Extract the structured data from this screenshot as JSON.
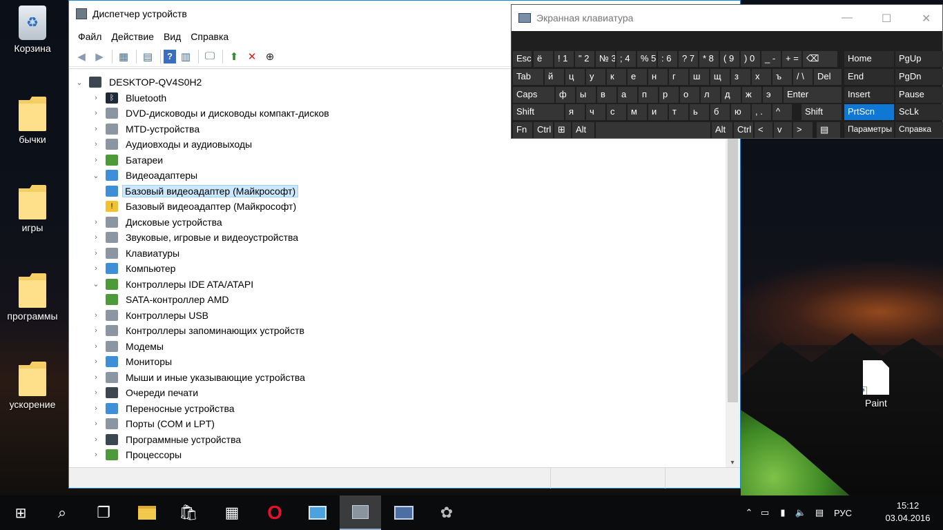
{
  "desktop": {
    "icons": [
      {
        "label": "Корзина"
      },
      {
        "label": "бычки"
      },
      {
        "label": "игры"
      },
      {
        "label": "программы"
      },
      {
        "label": "ускорение"
      },
      {
        "label": "Paint"
      }
    ]
  },
  "device_manager": {
    "title": "Диспетчер устройств",
    "menu": [
      "Файл",
      "Действие",
      "Вид",
      "Справка"
    ],
    "root": "DESKTOP-QV4S0H2",
    "tree": [
      {
        "label": "Bluetooth",
        "icon": "bluetooth-icon"
      },
      {
        "label": "DVD-дисководы и дисководы компакт-дисков",
        "icon": "dvd-drive-icon"
      },
      {
        "label": "MTD-устройства",
        "icon": "mtd-device-icon"
      },
      {
        "label": "Аудиовходы и аудиовыходы",
        "icon": "speaker-icon"
      },
      {
        "label": "Батареи",
        "icon": "battery-icon"
      },
      {
        "label": "Видеоадаптеры",
        "icon": "display-adapter-icon",
        "expanded": true
      },
      {
        "label": "Базовый видеоадаптер (Майкрософт)",
        "icon": "display-adapter-icon",
        "child": true,
        "selected": true
      },
      {
        "label": "Базовый видеоадаптер (Майкрософт)",
        "icon": "warning-icon",
        "child": true
      },
      {
        "label": "Дисковые устройства",
        "icon": "disk-drive-icon"
      },
      {
        "label": "Звуковые, игровые и видеоустройства",
        "icon": "speaker-icon"
      },
      {
        "label": "Клавиатуры",
        "icon": "keyboard-icon"
      },
      {
        "label": "Компьютер",
        "icon": "computer-icon"
      },
      {
        "label": "Контроллеры IDE ATA/ATAPI",
        "icon": "ide-controller-icon",
        "expanded": true
      },
      {
        "label": "SATA-контроллер AMD",
        "icon": "ide-controller-icon",
        "child": true
      },
      {
        "label": "Контроллеры USB",
        "icon": "usb-icon"
      },
      {
        "label": "Контроллеры запоминающих устройств",
        "icon": "storage-controller-icon"
      },
      {
        "label": "Модемы",
        "icon": "modem-icon"
      },
      {
        "label": "Мониторы",
        "icon": "monitor-icon"
      },
      {
        "label": "Мыши и иные указывающие устройства",
        "icon": "mouse-icon"
      },
      {
        "label": "Очереди печати",
        "icon": "printer-icon"
      },
      {
        "label": "Переносные устройства",
        "icon": "portable-device-icon"
      },
      {
        "label": "Порты (COM и LPT)",
        "icon": "port-icon"
      },
      {
        "label": "Программные устройства",
        "icon": "software-device-icon"
      },
      {
        "label": "Процессоры",
        "icon": "processor-icon"
      }
    ]
  },
  "osk": {
    "title": "Экранная клавиатура",
    "row1": [
      {
        "t": "Esc"
      },
      {
        "t": "ё"
      },
      {
        "t": "! 1"
      },
      {
        "t": "\" 2"
      },
      {
        "t": "№ 3"
      },
      {
        "t": "; 4"
      },
      {
        "t": "% 5"
      },
      {
        "t": ": 6"
      },
      {
        "t": "? 7"
      },
      {
        "t": "* 8"
      },
      {
        "t": "( 9"
      },
      {
        "t": ") 0"
      },
      {
        "t": "_ -"
      },
      {
        "t": "+ ="
      },
      {
        "t": "⌫"
      }
    ],
    "row2": [
      {
        "t": "Tab"
      },
      {
        "t": "й"
      },
      {
        "t": "ц"
      },
      {
        "t": "у"
      },
      {
        "t": "к"
      },
      {
        "t": "е"
      },
      {
        "t": "н"
      },
      {
        "t": "г"
      },
      {
        "t": "ш"
      },
      {
        "t": "щ"
      },
      {
        "t": "з"
      },
      {
        "t": "х"
      },
      {
        "t": "ъ"
      },
      {
        "t": "/ \\"
      },
      {
        "t": "Del"
      }
    ],
    "row3": [
      {
        "t": "Caps"
      },
      {
        "t": "ф"
      },
      {
        "t": "ы"
      },
      {
        "t": "в"
      },
      {
        "t": "а"
      },
      {
        "t": "п"
      },
      {
        "t": "р"
      },
      {
        "t": "о"
      },
      {
        "t": "л"
      },
      {
        "t": "д"
      },
      {
        "t": "ж"
      },
      {
        "t": "э"
      },
      {
        "t": "Enter"
      }
    ],
    "row4": [
      {
        "t": "Shift"
      },
      {
        "t": "я"
      },
      {
        "t": "ч"
      },
      {
        "t": "с"
      },
      {
        "t": "м"
      },
      {
        "t": "и"
      },
      {
        "t": "т"
      },
      {
        "t": "ь"
      },
      {
        "t": "б"
      },
      {
        "t": "ю"
      },
      {
        "t": ", ."
      },
      {
        "t": "^"
      },
      {
        "t": "Shift"
      }
    ],
    "row5": [
      {
        "t": "Fn"
      },
      {
        "t": "Ctrl"
      },
      {
        "t": "⊞"
      },
      {
        "t": "Alt"
      },
      {
        "t": ""
      },
      {
        "t": "Alt"
      },
      {
        "t": "Ctrl"
      },
      {
        "t": "<"
      },
      {
        "t": "v"
      },
      {
        "t": ">"
      },
      {
        "t": "▤"
      }
    ],
    "nav": [
      "Home",
      "PgUp",
      "End",
      "PgDn",
      "Insert",
      "Pause",
      "PrtScn",
      "ScLk",
      "Параметры",
      "Справка"
    ]
  },
  "taskbar": {
    "language": "РУС",
    "time": "15:12",
    "date": "03.04.2016"
  }
}
